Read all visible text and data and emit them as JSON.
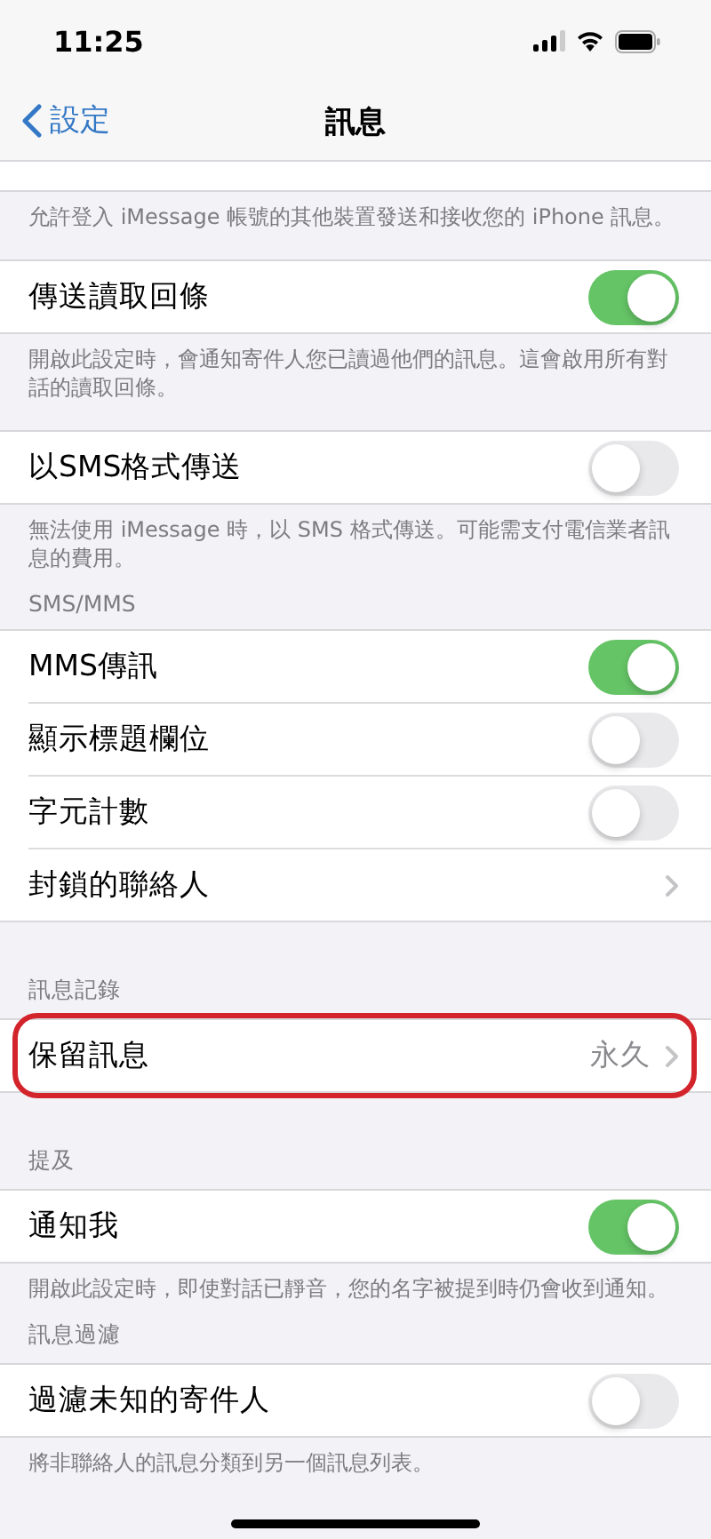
{
  "status_bar": {
    "time": "11:25"
  },
  "nav": {
    "back": "設定",
    "title": "訊息"
  },
  "sections": [
    {
      "cut_row": true,
      "footer": "允許登入 iMessage 帳號的其他裝置發送和接收您的 iPhone 訊息。"
    },
    {
      "rows": [
        {
          "kind": "toggle",
          "label": "傳送讀取回條",
          "on": true
        }
      ],
      "footer": "開啟此設定時，會通知寄件人您已讀過他們的訊息。這會啟用所有對話的讀取回條。"
    },
    {
      "rows": [
        {
          "kind": "toggle",
          "label": "以SMS格式傳送",
          "on": false
        }
      ],
      "footer": "無法使用 iMessage 時，以 SMS 格式傳送。可能需支付電信業者訊息的費用。"
    },
    {
      "header": "SMS/MMS",
      "rows": [
        {
          "kind": "toggle",
          "label": "MMS傳訊",
          "on": true
        },
        {
          "kind": "toggle",
          "label": "顯示標題欄位",
          "on": false
        },
        {
          "kind": "toggle",
          "label": "字元計數",
          "on": false
        },
        {
          "kind": "link",
          "label": "封鎖的聯絡人"
        }
      ]
    },
    {
      "header": "訊息記錄",
      "rows": [
        {
          "kind": "link",
          "label": "保留訊息",
          "value": "永久",
          "highlighted": true
        }
      ]
    },
    {
      "header": "提及",
      "rows": [
        {
          "kind": "toggle",
          "label": "通知我",
          "on": true
        }
      ],
      "footer": "開啟此設定時，即使對話已靜音，您的名字被提到時仍會收到通知。"
    },
    {
      "header": "訊息過濾",
      "rows": [
        {
          "kind": "toggle",
          "label": "過濾未知的寄件人",
          "on": false
        }
      ],
      "footer": "將非聯絡人的訊息分類到另一個訊息列表。"
    }
  ]
}
